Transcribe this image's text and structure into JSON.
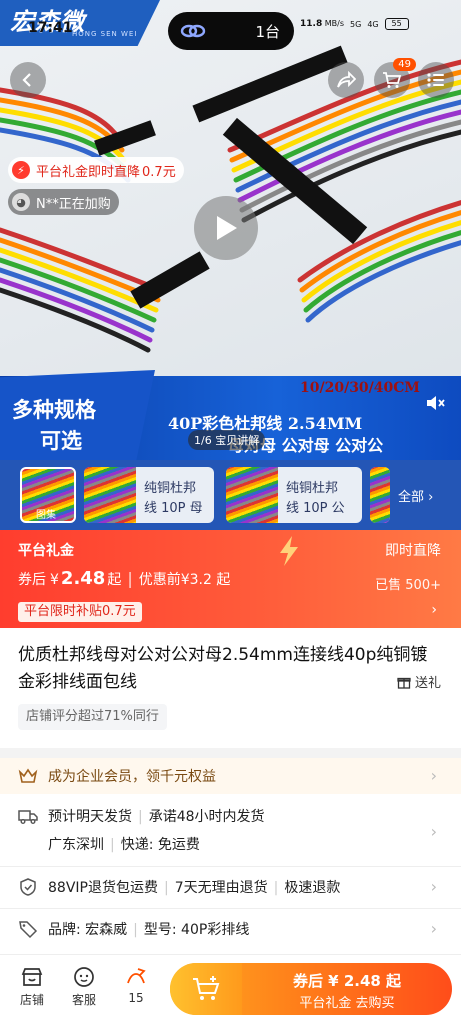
{
  "status": {
    "time": "17:41",
    "dynamic_island_count": "1台",
    "net_speed": "11.8",
    "net_unit": "MB/s",
    "signal": "5G",
    "signal2": "4G",
    "battery": "55"
  },
  "logo": {
    "text": "宏森微",
    "sub": "HONG SEN WEI"
  },
  "hero": {
    "cart_count": "49",
    "promo_pill": "平台礼金即时直降",
    "promo_amount": "0.7元",
    "buyer_pill": "N**正在加购",
    "banner_left_1": "多种规格",
    "banner_left_2": "可选",
    "banner_tag": "10/20/30/40CM",
    "banner_right_1": "40P彩色杜邦线 2.54MM",
    "banner_right_2": "母对母 公对母 公对公",
    "counter": "1/6 宝贝讲解"
  },
  "thumbs": {
    "items": [
      {
        "caption": "图集",
        "text": ""
      },
      {
        "caption": "",
        "text": "纯铜杜邦线 10P 母"
      },
      {
        "caption": "",
        "text": "纯铜杜邦线 10P 公"
      }
    ],
    "all_label": "全部"
  },
  "price": {
    "title": "平台礼金",
    "right_top": "即时直降",
    "after_label": "券后",
    "currency": "¥",
    "after_value": "2.48",
    "after_suffix": "起",
    "before_label": "优惠前¥3.2 起",
    "sold": "已售 500+",
    "subsidy": "平台限时补贴0.7元"
  },
  "product": {
    "title": "优质杜邦线母对公对公对母2.54mm连接线40p纯铜镀金彩排线面包线",
    "gift": "送礼",
    "score": "店铺评分超过71%同行"
  },
  "rows": {
    "member": "成为企业会员，领千元权益",
    "ship_1": "预计明天发货",
    "ship_2": "承诺48小时内发货",
    "origin": "广东深圳",
    "express": "快递: 免运费",
    "svc_1": "88VIP退货包运费",
    "svc_2": "7天无理由退货",
    "svc_3": "极速退款",
    "brand": "品牌: 宏森威",
    "model": "型号: 40P彩排线"
  },
  "bottom": {
    "shop": "店铺",
    "service": "客服",
    "fav_count": "15",
    "buy_line1": "券后 ¥ 2.48 起",
    "buy_line2": "平台礼金 去购买"
  },
  "colors": {
    "accent": "#ff5000",
    "brand_blue": "#1f5fbf",
    "promo_red": "#e0261a",
    "green": "#1ba34b"
  }
}
